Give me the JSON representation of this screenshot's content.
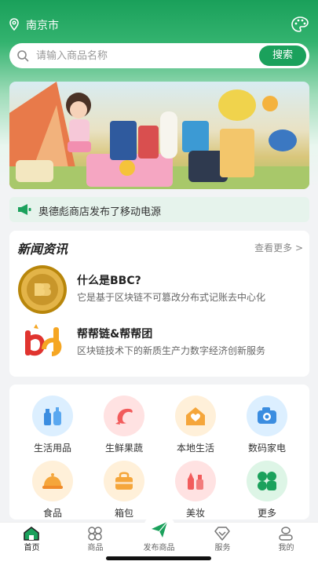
{
  "location": {
    "city": "南京市"
  },
  "search": {
    "placeholder": "请输入商品名称",
    "button_label": "搜索"
  },
  "notice": {
    "text": "奥德彪商店发布了移动电源"
  },
  "news": {
    "title": "新闻资讯",
    "more_label": "查看更多 >",
    "items": [
      {
        "title": "什么是BBC?",
        "desc": "它是基于区块链不可篡改分布式记账去中心化"
      },
      {
        "title": "帮帮链&帮帮团",
        "desc": "区块链技术下的新质生产力数字经济创新服务"
      }
    ]
  },
  "categories": [
    {
      "label": "生活用品",
      "icon": "toiletries-icon",
      "color": "#dcefff"
    },
    {
      "label": "生鲜果蔬",
      "icon": "shrimp-icon",
      "color": "#ffe2e2"
    },
    {
      "label": "本地生活",
      "icon": "house-icon",
      "color": "#fff0d9"
    },
    {
      "label": "数码家电",
      "icon": "camera-icon",
      "color": "#dcefff"
    },
    {
      "label": "食品",
      "icon": "cloche-icon",
      "color": "#fff0d9"
    },
    {
      "label": "箱包",
      "icon": "bag-icon",
      "color": "#fff0d9"
    },
    {
      "label": "美妆",
      "icon": "cosmetics-icon",
      "color": "#ffe2e2"
    },
    {
      "label": "更多",
      "icon": "more-icon",
      "color": "#ddf5e6"
    }
  ],
  "tabbar": {
    "tabs": [
      {
        "label": "首页",
        "icon": "home-icon",
        "active": true
      },
      {
        "label": "商品",
        "icon": "grid-icon",
        "active": false
      },
      {
        "label": "发布商品",
        "icon": "send-icon",
        "active": false
      },
      {
        "label": "服务",
        "icon": "diamond-icon",
        "active": false
      },
      {
        "label": "我的",
        "icon": "user-icon",
        "active": false
      }
    ]
  },
  "colors": {
    "brand": "#1ba15c",
    "accent_red": "#f25c5c",
    "accent_orange": "#f5a63b",
    "accent_blue": "#3b8de0"
  }
}
